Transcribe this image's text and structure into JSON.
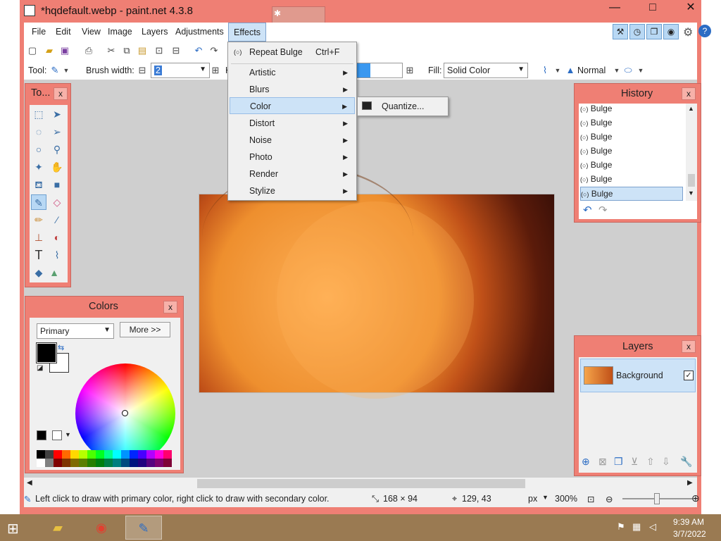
{
  "window": {
    "title": "*hqdefault.webp - paint.net 4.3.8",
    "min_label": "—",
    "max_label": "□",
    "close_label": "✕"
  },
  "menubar": {
    "items": [
      "File",
      "Edit",
      "View",
      "Image",
      "Layers",
      "Adjustments",
      "Effects"
    ]
  },
  "effects_menu": {
    "repeat": {
      "label": "Repeat Bulge",
      "shortcut": "Ctrl+F"
    },
    "items": [
      "Artistic",
      "Blurs",
      "Color",
      "Distort",
      "Noise",
      "Photo",
      "Render",
      "Stylize"
    ],
    "highlighted": "Color"
  },
  "color_submenu": {
    "items": [
      "Quantize..."
    ]
  },
  "toolbar": {
    "tool_label": "Tool:",
    "brush_width_label": "Brush width:",
    "brush_width_value": "2",
    "hardness_label": "H",
    "fill_label": "Fill:",
    "fill_value": "Solid Color",
    "blend_value": "Normal"
  },
  "tools_panel": {
    "title": "To...",
    "close": "x"
  },
  "colors_panel": {
    "title": "Colors",
    "close": "x",
    "mode_value": "Primary",
    "more_label": "More >>",
    "primary_color": "#000000",
    "secondary_color": "#ffffff"
  },
  "history_panel": {
    "title": "History",
    "close": "x",
    "items": [
      "Bulge",
      "Bulge",
      "Bulge",
      "Bulge",
      "Bulge",
      "Bulge",
      "Bulge"
    ],
    "selected_index": 6
  },
  "layers_panel": {
    "title": "Layers",
    "close": "x",
    "layers": [
      {
        "name": "Background",
        "visible": true
      }
    ]
  },
  "statusbar": {
    "hint": "Left click to draw with primary color, right click to draw with secondary color.",
    "size": "168 × 94",
    "position": "129, 43",
    "unit": "px",
    "zoom": "300%"
  },
  "taskbar": {
    "time": "9:39 AM",
    "date": "3/7/2022"
  },
  "colors": {
    "window_accent": "#ef7f74",
    "highlight": "#cde3f7"
  }
}
